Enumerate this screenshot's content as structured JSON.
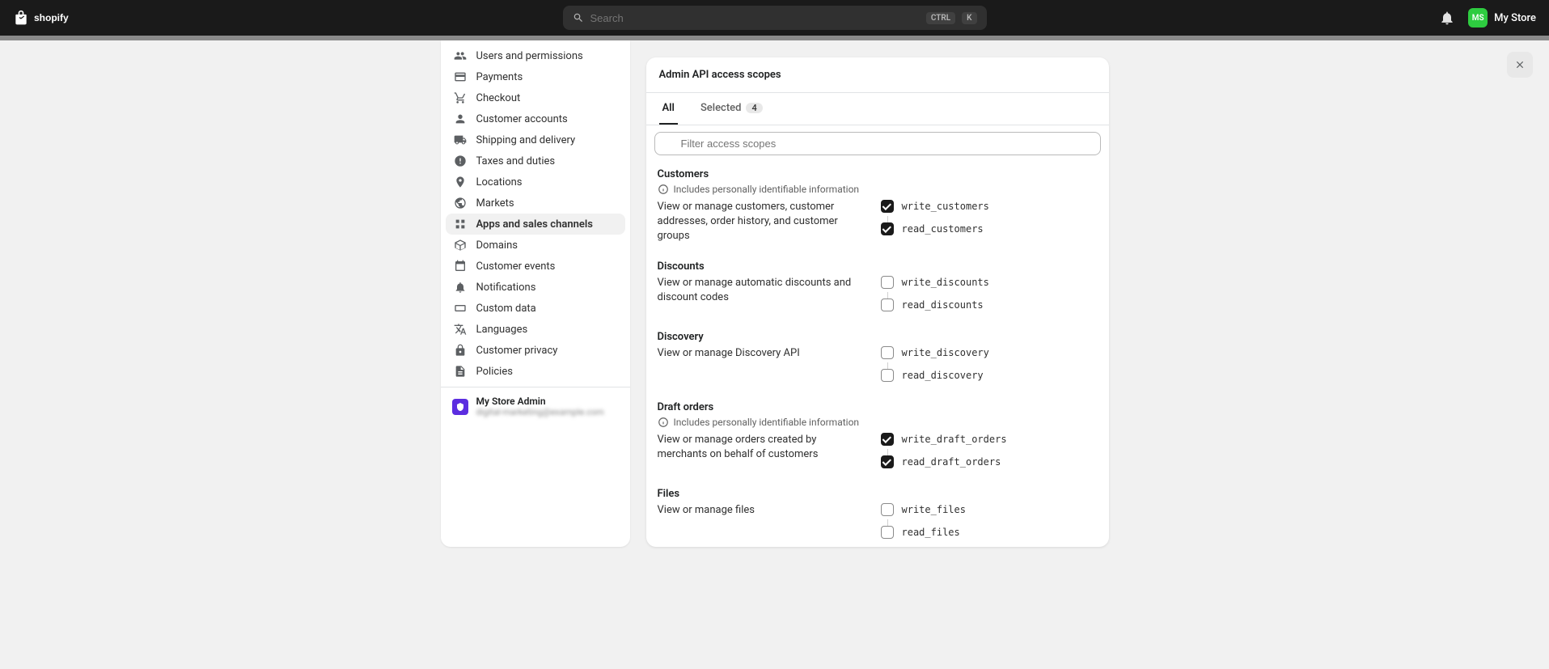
{
  "header": {
    "search_placeholder": "Search",
    "kbd1": "CTRL",
    "kbd2": "K",
    "store_initials": "MS",
    "store_name": "My Store"
  },
  "sidebar": {
    "items": [
      {
        "label": "Users and permissions",
        "icon": "users"
      },
      {
        "label": "Payments",
        "icon": "credit-card"
      },
      {
        "label": "Checkout",
        "icon": "cart"
      },
      {
        "label": "Customer accounts",
        "icon": "user"
      },
      {
        "label": "Shipping and delivery",
        "icon": "truck"
      },
      {
        "label": "Taxes and duties",
        "icon": "tax"
      },
      {
        "label": "Locations",
        "icon": "location"
      },
      {
        "label": "Markets",
        "icon": "globe"
      },
      {
        "label": "Apps and sales channels",
        "icon": "apps",
        "active": true
      },
      {
        "label": "Domains",
        "icon": "domain"
      },
      {
        "label": "Customer events",
        "icon": "events"
      },
      {
        "label": "Notifications",
        "icon": "bell"
      },
      {
        "label": "Custom data",
        "icon": "data"
      },
      {
        "label": "Languages",
        "icon": "lang"
      },
      {
        "label": "Customer privacy",
        "icon": "lock"
      },
      {
        "label": "Policies",
        "icon": "policy"
      }
    ],
    "footer": {
      "name": "My Store Admin",
      "sub": "digital-marketing@example.com"
    }
  },
  "panel": {
    "title": "Admin API access scopes",
    "tabs": {
      "all": "All",
      "selected": "Selected",
      "selected_count": "4"
    },
    "filter_placeholder": "Filter access scopes",
    "pii_text": "Includes personally identifiable information",
    "scopes": [
      {
        "title": "Customers",
        "pii": true,
        "desc": "View or manage customers, customer addresses, order history, and customer groups",
        "write": {
          "label": "write_customers",
          "checked": true
        },
        "read": {
          "label": "read_customers",
          "checked": true
        }
      },
      {
        "title": "Discounts",
        "pii": false,
        "desc": "View or manage automatic discounts and discount codes",
        "write": {
          "label": "write_discounts",
          "checked": false
        },
        "read": {
          "label": "read_discounts",
          "checked": false
        }
      },
      {
        "title": "Discovery",
        "pii": false,
        "desc": "View or manage Discovery API",
        "write": {
          "label": "write_discovery",
          "checked": false
        },
        "read": {
          "label": "read_discovery",
          "checked": false
        }
      },
      {
        "title": "Draft orders",
        "pii": true,
        "desc": "View or manage orders created by merchants on behalf of customers",
        "write": {
          "label": "write_draft_orders",
          "checked": true
        },
        "read": {
          "label": "read_draft_orders",
          "checked": true
        }
      },
      {
        "title": "Files",
        "pii": false,
        "desc": "View or manage files",
        "write": {
          "label": "write_files",
          "checked": false
        },
        "read": {
          "label": "read_files",
          "checked": false
        }
      }
    ]
  }
}
